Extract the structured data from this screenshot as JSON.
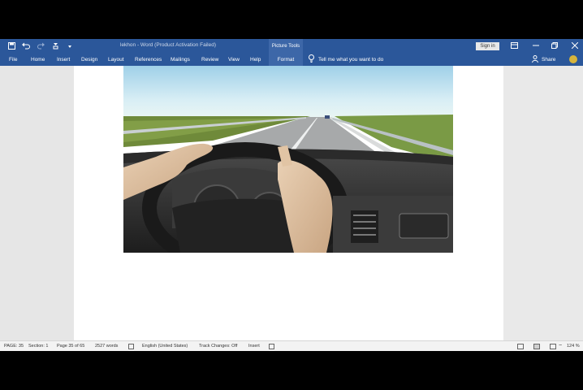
{
  "titlebar": {
    "title": "lekhon  -  Word (Product Activation Failed)",
    "context_tab": "Picture Tools",
    "sign_in": "Sign in",
    "qat_icons": [
      "save-icon",
      "undo-icon",
      "redo-icon",
      "customize-icon"
    ]
  },
  "ribbon": {
    "tabs": [
      "File",
      "Home",
      "Insert",
      "Design",
      "Layout",
      "References",
      "Mailings",
      "Review",
      "View",
      "Help",
      "Format"
    ],
    "tell_me": "Tell me what you want to do",
    "share": "Share"
  },
  "document": {
    "image_description_icon": "driving-car-photo"
  },
  "status": {
    "page": "PAGE: 35",
    "section": "Section: 1",
    "page_of": "Page 35 of 65",
    "words": "2527 words",
    "language": "English (United States)",
    "track_changes": "Track Changes: Off",
    "mode": "Insert",
    "zoom": "124 %"
  },
  "colors": {
    "ribbon": "#2b579a",
    "accent_tab": "#3d67a8"
  }
}
